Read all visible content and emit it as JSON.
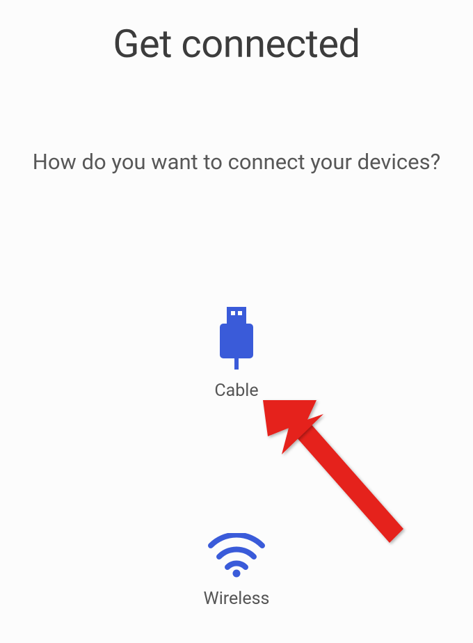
{
  "header": {
    "title": "Get connected",
    "subtitle": "How do you want to connect your devices?"
  },
  "options": {
    "cable": {
      "label": "Cable"
    },
    "wireless": {
      "label": "Wireless"
    }
  },
  "colors": {
    "accent": "#3a5bd9",
    "arrow": "#e5201b"
  }
}
